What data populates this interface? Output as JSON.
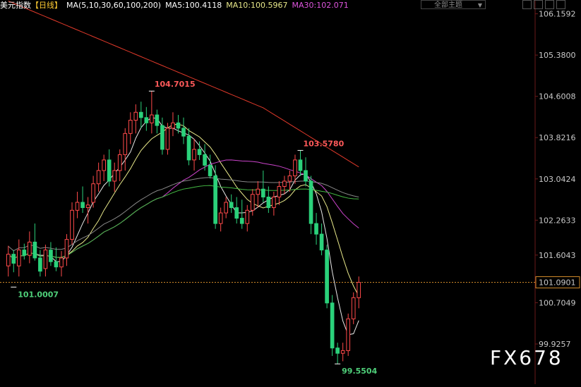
{
  "header": {
    "symbol": "美元指数",
    "period": "【日线】",
    "indicator": "MA(5,10,30,60,100,200)",
    "ma5": "MA5:100.4118",
    "ma10": "MA10:100.5967",
    "ma30": "MA30:102.071"
  },
  "toolbar": {
    "theme_dropdown": "全部主题"
  },
  "colors": {
    "up": "#ff4a4a",
    "down": "#2bd17a",
    "ma5": "#e8e8e8",
    "ma10": "#e8e88a",
    "ma30": "#cc44cc",
    "ma60": "#44bb44",
    "ma100": "#888888",
    "ma200": "#e0392a",
    "price_line": "#d08a2a"
  },
  "annotations": {
    "high1": "104.7015",
    "high2": "103.5780",
    "low1": "101.0007",
    "low2": "99.5504"
  },
  "watermark": "FX678",
  "chart_data": {
    "type": "candlestick",
    "y_ticks": [
      "106.1592",
      "105.3800",
      "104.6008",
      "103.8216",
      "103.0424",
      "102.2633",
      "101.6043",
      "101.0901",
      "100.7049",
      "99.9257"
    ],
    "current_price": "101.0901",
    "ylim": [
      99.3,
      106.3
    ],
    "candles": [
      [
        101.4,
        101.78,
        101.2,
        101.62
      ],
      [
        101.62,
        101.7,
        101.28,
        101.45
      ],
      [
        101.4,
        101.9,
        101.2,
        101.7
      ],
      [
        101.7,
        101.82,
        101.52,
        101.6
      ],
      [
        101.6,
        102.05,
        101.45,
        101.85
      ],
      [
        101.85,
        102.2,
        101.5,
        101.55
      ],
      [
        101.55,
        101.7,
        101.2,
        101.3
      ],
      [
        101.35,
        101.8,
        101.2,
        101.7
      ],
      [
        101.7,
        101.85,
        101.4,
        101.48
      ],
      [
        101.48,
        101.75,
        101.3,
        101.38
      ],
      [
        101.38,
        101.68,
        101.2,
        101.55
      ],
      [
        101.55,
        102.0,
        101.4,
        101.9
      ],
      [
        101.9,
        102.6,
        101.8,
        102.45
      ],
      [
        102.45,
        102.8,
        102.3,
        102.6
      ],
      [
        102.6,
        102.9,
        102.4,
        102.5
      ],
      [
        102.5,
        102.7,
        102.2,
        102.55
      ],
      [
        102.6,
        103.1,
        102.5,
        102.95
      ],
      [
        102.95,
        103.35,
        102.8,
        103.2
      ],
      [
        103.2,
        103.5,
        103.0,
        103.4
      ],
      [
        103.4,
        103.6,
        102.9,
        103.0
      ],
      [
        103.0,
        103.35,
        102.8,
        103.2
      ],
      [
        103.2,
        103.6,
        103.0,
        103.5
      ],
      [
        103.5,
        104.0,
        103.2,
        103.9
      ],
      [
        103.9,
        104.3,
        103.7,
        104.15
      ],
      [
        104.15,
        104.45,
        103.9,
        104.3
      ],
      [
        104.3,
        104.5,
        104.0,
        104.2
      ],
      [
        104.2,
        104.4,
        103.95,
        104.1
      ],
      [
        104.1,
        104.7,
        103.9,
        104.25
      ],
      [
        104.25,
        104.35,
        103.9,
        104.05
      ],
      [
        104.05,
        104.2,
        103.5,
        103.6
      ],
      [
        103.6,
        104.1,
        103.5,
        104.0
      ],
      [
        104.0,
        104.3,
        103.85,
        104.1
      ],
      [
        104.1,
        104.25,
        103.9,
        104.0
      ],
      [
        104.0,
        104.2,
        103.7,
        103.85
      ],
      [
        103.85,
        104.0,
        103.3,
        103.4
      ],
      [
        103.4,
        103.8,
        103.2,
        103.6
      ],
      [
        103.6,
        103.75,
        103.4,
        103.5
      ],
      [
        103.5,
        103.7,
        103.2,
        103.3
      ],
      [
        103.3,
        103.5,
        103.05,
        103.1
      ],
      [
        103.1,
        103.3,
        102.1,
        102.2
      ],
      [
        102.2,
        102.5,
        102.05,
        102.4
      ],
      [
        102.4,
        102.7,
        102.3,
        102.6
      ],
      [
        102.6,
        102.75,
        102.4,
        102.5
      ],
      [
        102.5,
        102.7,
        102.2,
        102.3
      ],
      [
        102.3,
        102.65,
        102.1,
        102.2
      ],
      [
        102.2,
        102.55,
        102.05,
        102.45
      ],
      [
        102.45,
        102.85,
        102.35,
        102.75
      ],
      [
        102.75,
        103.0,
        102.5,
        102.85
      ],
      [
        102.85,
        103.2,
        102.6,
        102.7
      ],
      [
        102.7,
        102.9,
        102.4,
        102.5
      ],
      [
        102.5,
        102.8,
        102.35,
        102.7
      ],
      [
        102.7,
        103.0,
        102.55,
        102.9
      ],
      [
        102.9,
        103.1,
        102.75,
        103.0
      ],
      [
        103.0,
        103.2,
        102.8,
        103.1
      ],
      [
        103.1,
        103.5,
        102.95,
        103.4
      ],
      [
        103.4,
        103.58,
        103.1,
        103.2
      ],
      [
        103.2,
        103.45,
        102.9,
        103.0
      ],
      [
        103.0,
        103.1,
        102.0,
        102.2
      ],
      [
        102.2,
        102.4,
        101.8,
        102.0
      ],
      [
        102.0,
        102.2,
        101.6,
        101.7
      ],
      [
        101.7,
        101.8,
        100.6,
        100.7
      ],
      [
        100.7,
        100.85,
        99.7,
        99.85
      ],
      [
        99.85,
        99.95,
        99.55,
        99.75
      ],
      [
        99.75,
        99.95,
        99.6,
        99.8
      ],
      [
        99.8,
        100.5,
        99.7,
        100.4
      ],
      [
        100.4,
        100.9,
        100.3,
        100.8
      ],
      [
        100.8,
        101.2,
        100.6,
        101.09
      ]
    ]
  }
}
